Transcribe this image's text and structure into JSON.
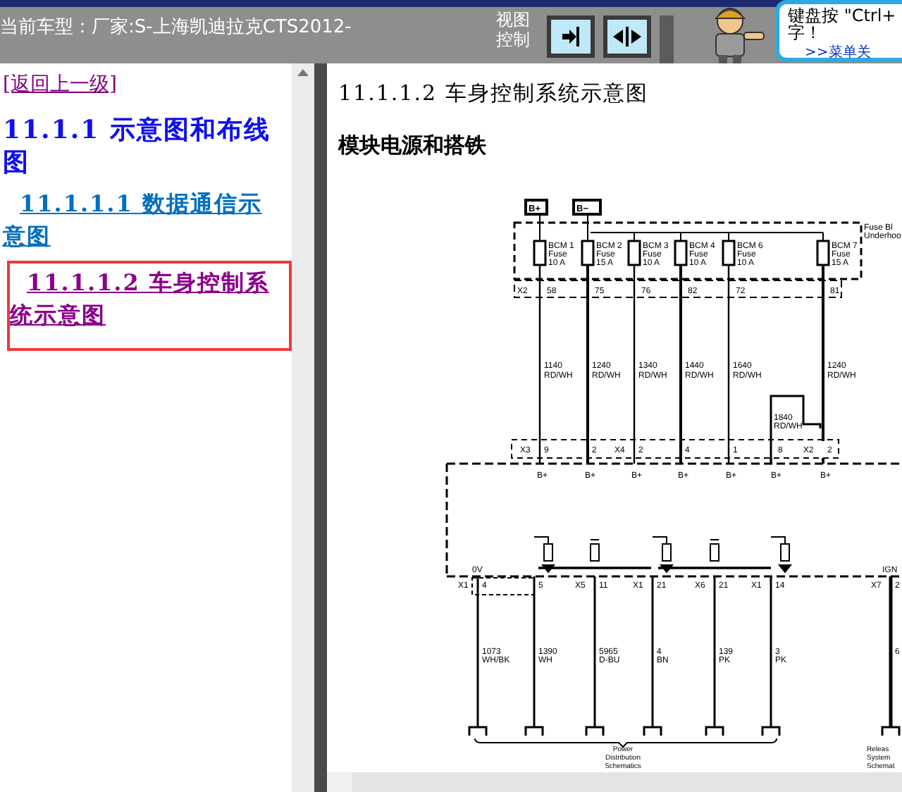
{
  "header": {
    "vehicle": "当前车型：厂家:S-上海凯迪拉克CTS2012-",
    "view_control_label": "视图控制",
    "view_buttons": [
      {
        "kind": "expand"
      },
      {
        "kind": "split"
      }
    ],
    "help_box": {
      "lines": [
        "键盘按 \"Ctrl+",
        "字！"
      ],
      "link": ">>菜单关"
    }
  },
  "nav": {
    "back_link": "[返回上一级]",
    "items": [
      {
        "label": "11.1.1 示意图和布线图",
        "kind": "heading",
        "selected": false
      },
      {
        "label": "11.1.1.1 数据通信示意图",
        "kind": "link",
        "visited": false,
        "selected": false
      },
      {
        "label": "11.1.1.2 车身控制系统示意图",
        "kind": "link",
        "visited": true,
        "selected": true
      }
    ]
  },
  "content": {
    "title": "11.1.1.2 车身控制系统示意图",
    "subtitle": "模块电源和搭铁",
    "diagram": {
      "supplies": [
        "B+",
        "B−"
      ],
      "fuse_block_label": [
        "Fuse Bl",
        "Underhoo"
      ],
      "upper_connector": "X2",
      "fuses": [
        {
          "name": "BCM 1",
          "label": "Fuse",
          "rating": "10 A",
          "pin": "58",
          "wire": "1140",
          "wire_color": "RD/WH"
        },
        {
          "name": "BCM 2",
          "label": "Fuse",
          "rating": "15 A",
          "pin": "75",
          "wire": "1240",
          "wire_color": "RD/WH"
        },
        {
          "name": "BCM 3",
          "label": "Fuse",
          "rating": "10 A",
          "pin": "76",
          "wire": "1340",
          "wire_color": "RD/WH"
        },
        {
          "name": "BCM 4",
          "label": "Fuse",
          "rating": "10 A",
          "pin": "82",
          "wire": "1440",
          "wire_color": "RD/WH"
        },
        {
          "name": "BCM 6",
          "label": "Fuse",
          "rating": "10 A",
          "pin": "72",
          "wire": "1640",
          "wire_color": "RD/WH"
        },
        {
          "name": "BCM 7",
          "label": "Fuse",
          "rating": "15 A",
          "pin": "81",
          "wire": "1240",
          "wire_color": "RD/WH"
        }
      ],
      "jumper_wire": {
        "wire": "1840",
        "wire_color": "RD/WH"
      },
      "module_inputs": [
        {
          "connector": "X3",
          "pin": "9",
          "signal": "B+"
        },
        {
          "pin": "2",
          "signal": "B+"
        },
        {
          "connector": "X4",
          "pin": "2",
          "signal": "B+"
        },
        {
          "pin": "4",
          "signal": "B+"
        },
        {
          "pin": "1",
          "signal": "B+"
        },
        {
          "pin": "8",
          "signal": "B+"
        },
        {
          "connector": "X2",
          "pin": "2",
          "signal": "B+"
        }
      ],
      "lower_signals": [
        "0V",
        "IGN"
      ],
      "outputs": [
        {
          "connector": "X1",
          "pin": "4",
          "wire": "1073",
          "wire_color": "WH/BK"
        },
        {
          "pin": "5",
          "wire": "1390",
          "wire_color": "WH"
        },
        {
          "connector": "X5",
          "pin": "11",
          "wire": "5965",
          "wire_color": "D-BU"
        },
        {
          "connector": "X1",
          "pin": "21",
          "wire": "4",
          "wire_color": "BN"
        },
        {
          "connector": "X6",
          "pin": "21",
          "wire": "139",
          "wire_color": "PK"
        },
        {
          "connector": "X1",
          "pin": "14",
          "wire": "3",
          "wire_color": "PK"
        },
        {
          "connector": "X7",
          "pin": "2",
          "wire": "6"
        }
      ],
      "references": [
        {
          "lines": [
            "Power",
            "Distribution",
            "Schematics"
          ]
        },
        {
          "lines": [
            "Releas",
            "System",
            "Schemat"
          ]
        }
      ]
    }
  }
}
